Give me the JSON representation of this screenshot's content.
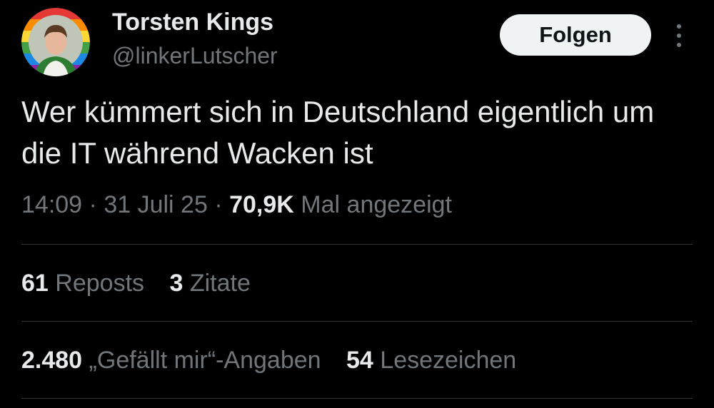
{
  "author": {
    "display_name": "Torsten Kings",
    "handle": "@linkerLutscher"
  },
  "follow_button": {
    "label": "Folgen"
  },
  "more_icon": "vertical-ellipsis",
  "tweet": {
    "text": "Wer kümmert sich in Deutschland eigentlich um die IT während Wacken ist",
    "time": "14:09",
    "separator": "·",
    "date": "31 Juli 25",
    "views_count": "70,9K",
    "views_label": "Mal angezeigt"
  },
  "stats": {
    "reposts_count": "61",
    "reposts_label": "Reposts",
    "quotes_count": "3",
    "quotes_label": "Zitate",
    "likes_count": "2.480",
    "likes_label": "„Gefällt mir“-Angaben",
    "bookmarks_count": "54",
    "bookmarks_label": "Lesezeichen"
  },
  "colors": {
    "background": "#000000",
    "primary_text": "#e7e9ea",
    "secondary_text": "#71767b",
    "divider": "#2f3336",
    "button_background": "#eff3f4",
    "button_text": "#0f1419"
  }
}
